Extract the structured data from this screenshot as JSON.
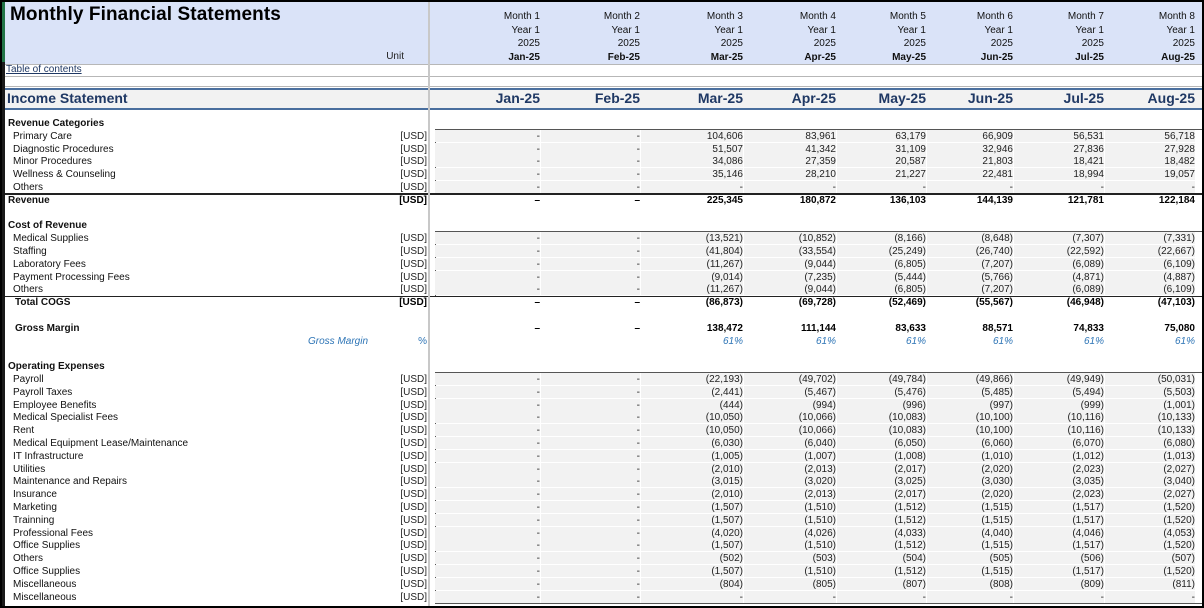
{
  "title": "Monthly Financial Statements",
  "unit_header": "Unit",
  "toc_link": "Table of contents",
  "months": [
    {
      "month": "Month 1",
      "year": "Year 1",
      "cal": "2025",
      "label": "Jan-25"
    },
    {
      "month": "Month 2",
      "year": "Year 1",
      "cal": "2025",
      "label": "Feb-25"
    },
    {
      "month": "Month 3",
      "year": "Year 1",
      "cal": "2025",
      "label": "Mar-25"
    },
    {
      "month": "Month 4",
      "year": "Year 1",
      "cal": "2025",
      "label": "Apr-25"
    },
    {
      "month": "Month 5",
      "year": "Year 1",
      "cal": "2025",
      "label": "May-25"
    },
    {
      "month": "Month 6",
      "year": "Year 1",
      "cal": "2025",
      "label": "Jun-25"
    },
    {
      "month": "Month 7",
      "year": "Year 1",
      "cal": "2025",
      "label": "Jul-25"
    },
    {
      "month": "Month 8",
      "year": "Year 1",
      "cal": "2025",
      "label": "Aug-25"
    }
  ],
  "income_statement": {
    "title": "Income Statement",
    "revenue_categories": {
      "title": "Revenue Categories",
      "rows": [
        {
          "label": "Primary Care",
          "unit": "[USD]",
          "values": [
            "-",
            "-",
            "104,606",
            "83,961",
            "63,179",
            "66,909",
            "56,531",
            "56,718"
          ]
        },
        {
          "label": "Diagnostic Procedures",
          "unit": "[USD]",
          "values": [
            "-",
            "-",
            "51,507",
            "41,342",
            "31,109",
            "32,946",
            "27,836",
            "27,928"
          ]
        },
        {
          "label": "Minor Procedures",
          "unit": "[USD]",
          "values": [
            "-",
            "-",
            "34,086",
            "27,359",
            "20,587",
            "21,803",
            "18,421",
            "18,482"
          ]
        },
        {
          "label": "Wellness & Counseling",
          "unit": "[USD]",
          "values": [
            "-",
            "-",
            "35,146",
            "28,210",
            "21,227",
            "22,481",
            "18,994",
            "19,057"
          ]
        },
        {
          "label": "Others",
          "unit": "[USD]",
          "values": [
            "-",
            "-",
            "-",
            "-",
            "-",
            "-",
            "-",
            "-"
          ]
        }
      ],
      "total": {
        "label": "Revenue",
        "unit": "[USD]",
        "values": [
          "–",
          "–",
          "225,345",
          "180,872",
          "136,103",
          "144,139",
          "121,781",
          "122,184"
        ]
      }
    },
    "cost_of_revenue": {
      "title": "Cost of Revenue",
      "rows": [
        {
          "label": "Medical Supplies",
          "unit": "[USD]",
          "values": [
            "-",
            "-",
            "(13,521)",
            "(10,852)",
            "(8,166)",
            "(8,648)",
            "(7,307)",
            "(7,331)"
          ]
        },
        {
          "label": "Staffing",
          "unit": "[USD]",
          "values": [
            "-",
            "-",
            "(41,804)",
            "(33,554)",
            "(25,249)",
            "(26,740)",
            "(22,592)",
            "(22,667)"
          ]
        },
        {
          "label": "Laboratory Fees",
          "unit": "[USD]",
          "values": [
            "-",
            "-",
            "(11,267)",
            "(9,044)",
            "(6,805)",
            "(7,207)",
            "(6,089)",
            "(6,109)"
          ]
        },
        {
          "label": "Payment Processing Fees",
          "unit": "[USD]",
          "values": [
            "-",
            "-",
            "(9,014)",
            "(7,235)",
            "(5,444)",
            "(5,766)",
            "(4,871)",
            "(4,887)"
          ]
        },
        {
          "label": "Others",
          "unit": "[USD]",
          "values": [
            "-",
            "-",
            "(11,267)",
            "(9,044)",
            "(6,805)",
            "(7,207)",
            "(6,089)",
            "(6,109)"
          ]
        }
      ],
      "total": {
        "label": "Total COGS",
        "unit": "[USD]",
        "values": [
          "–",
          "–",
          "(86,873)",
          "(69,728)",
          "(52,469)",
          "(55,567)",
          "(46,948)",
          "(47,103)"
        ]
      }
    },
    "gross_margin": {
      "label": "Gross Margin",
      "values": [
        "–",
        "–",
        "138,472",
        "111,144",
        "83,633",
        "88,571",
        "74,833",
        "75,080"
      ],
      "pct_label": "Gross Margin",
      "pct_unit": "%",
      "pct_values": [
        "",
        "",
        "61%",
        "61%",
        "61%",
        "61%",
        "61%",
        "61%"
      ]
    },
    "operating_expenses": {
      "title": "Operating Expenses",
      "rows": [
        {
          "label": "Payroll",
          "unit": "[USD]",
          "values": [
            "-",
            "-",
            "(22,193)",
            "(49,702)",
            "(49,784)",
            "(49,866)",
            "(49,949)",
            "(50,031)"
          ]
        },
        {
          "label": "Payroll Taxes",
          "unit": "[USD]",
          "values": [
            "-",
            "-",
            "(2,441)",
            "(5,467)",
            "(5,476)",
            "(5,485)",
            "(5,494)",
            "(5,503)"
          ]
        },
        {
          "label": "Employee Benefits",
          "unit": "[USD]",
          "values": [
            "-",
            "-",
            "(444)",
            "(994)",
            "(996)",
            "(997)",
            "(999)",
            "(1,001)"
          ]
        },
        {
          "label": "Medical Specialist Fees",
          "unit": "[USD]",
          "values": [
            "-",
            "-",
            "(10,050)",
            "(10,066)",
            "(10,083)",
            "(10,100)",
            "(10,116)",
            "(10,133)"
          ]
        },
        {
          "label": "Rent",
          "unit": "[USD]",
          "values": [
            "-",
            "-",
            "(10,050)",
            "(10,066)",
            "(10,083)",
            "(10,100)",
            "(10,116)",
            "(10,133)"
          ]
        },
        {
          "label": "Medical Equipment Lease/Maintenance",
          "unit": "[USD]",
          "values": [
            "-",
            "-",
            "(6,030)",
            "(6,040)",
            "(6,050)",
            "(6,060)",
            "(6,070)",
            "(6,080)"
          ]
        },
        {
          "label": "IT Infrastructure",
          "unit": "[USD]",
          "values": [
            "-",
            "-",
            "(1,005)",
            "(1,007)",
            "(1,008)",
            "(1,010)",
            "(1,012)",
            "(1,013)"
          ]
        },
        {
          "label": "Utilities",
          "unit": "[USD]",
          "values": [
            "-",
            "-",
            "(2,010)",
            "(2,013)",
            "(2,017)",
            "(2,020)",
            "(2,023)",
            "(2,027)"
          ]
        },
        {
          "label": "Maintenance and Repairs",
          "unit": "[USD]",
          "values": [
            "-",
            "-",
            "(3,015)",
            "(3,020)",
            "(3,025)",
            "(3,030)",
            "(3,035)",
            "(3,040)"
          ]
        },
        {
          "label": "Insurance",
          "unit": "[USD]",
          "values": [
            "-",
            "-",
            "(2,010)",
            "(2,013)",
            "(2,017)",
            "(2,020)",
            "(2,023)",
            "(2,027)"
          ]
        },
        {
          "label": "Marketing",
          "unit": "[USD]",
          "values": [
            "-",
            "-",
            "(1,507)",
            "(1,510)",
            "(1,512)",
            "(1,515)",
            "(1,517)",
            "(1,520)"
          ]
        },
        {
          "label": "Trainning",
          "unit": "[USD]",
          "values": [
            "-",
            "-",
            "(1,507)",
            "(1,510)",
            "(1,512)",
            "(1,515)",
            "(1,517)",
            "(1,520)"
          ]
        },
        {
          "label": "Professional Fees",
          "unit": "[USD]",
          "values": [
            "-",
            "-",
            "(4,020)",
            "(4,026)",
            "(4,033)",
            "(4,040)",
            "(4,046)",
            "(4,053)"
          ]
        },
        {
          "label": "Office Supplies",
          "unit": "[USD]",
          "values": [
            "-",
            "-",
            "(1,507)",
            "(1,510)",
            "(1,512)",
            "(1,515)",
            "(1,517)",
            "(1,520)"
          ]
        },
        {
          "label": "Others",
          "unit": "[USD]",
          "values": [
            "-",
            "-",
            "(502)",
            "(503)",
            "(504)",
            "(505)",
            "(506)",
            "(507)"
          ]
        },
        {
          "label": "Office Supplies",
          "unit": "[USD]",
          "values": [
            "-",
            "-",
            "(1,507)",
            "(1,510)",
            "(1,512)",
            "(1,515)",
            "(1,517)",
            "(1,520)"
          ]
        },
        {
          "label": "Miscellaneous",
          "unit": "[USD]",
          "values": [
            "-",
            "-",
            "(804)",
            "(805)",
            "(807)",
            "(808)",
            "(809)",
            "(811)"
          ]
        },
        {
          "label": "Miscellaneous",
          "unit": "[USD]",
          "values": [
            "-",
            "-",
            "-",
            "-",
            "-",
            "-",
            "-",
            "-"
          ]
        }
      ]
    }
  }
}
